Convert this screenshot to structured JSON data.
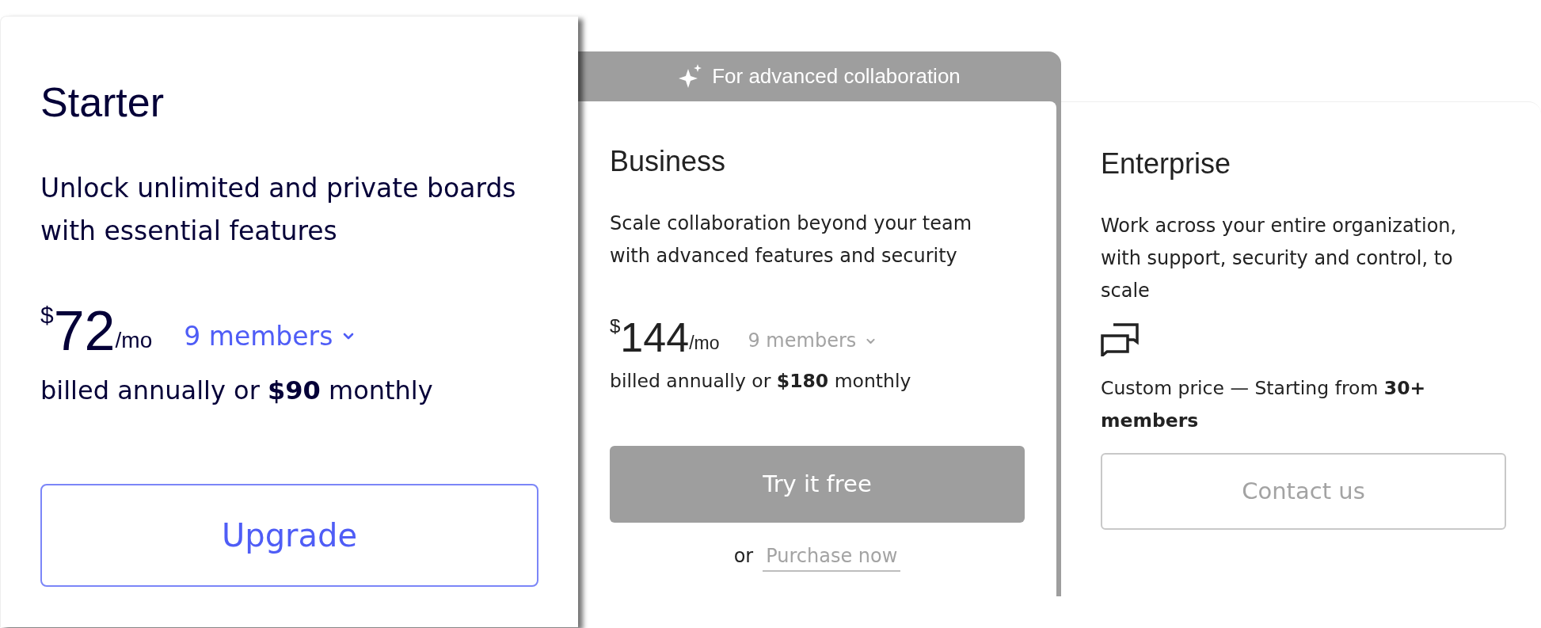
{
  "plans": [
    {
      "name": "Starter",
      "selected": true,
      "description": "Unlock unlimited and private boards with essential features",
      "price": {
        "kind": "amount",
        "currency": "$",
        "amount": "72",
        "period": "/mo",
        "members": "9 members",
        "billing": "billed annually or **$90** monthly"
      },
      "button": {
        "label": "Upgrade",
        "kind": "outline"
      }
    },
    {
      "name": "Business",
      "selected": false,
      "banner": "For advanced collaboration",
      "description": "Scale collaboration beyond your team with advanced features and security",
      "price": {
        "kind": "amount",
        "currency": "$",
        "amount": "144",
        "period": "/mo",
        "members": "9 members",
        "billing": "billed annually or **$180** monthly"
      },
      "button": {
        "label": "Try it free",
        "kind": "filled"
      },
      "alt_action": {
        "prefix": "or",
        "link": "Purchase now"
      }
    },
    {
      "name": "Enterprise",
      "selected": false,
      "description": "Work across your entire organization, with support, security and control, to scale",
      "price": {
        "kind": "custom",
        "text": "Custom price — Starting from **30+ members**"
      },
      "button": {
        "label": "Contact us",
        "kind": "outline"
      }
    }
  ]
}
